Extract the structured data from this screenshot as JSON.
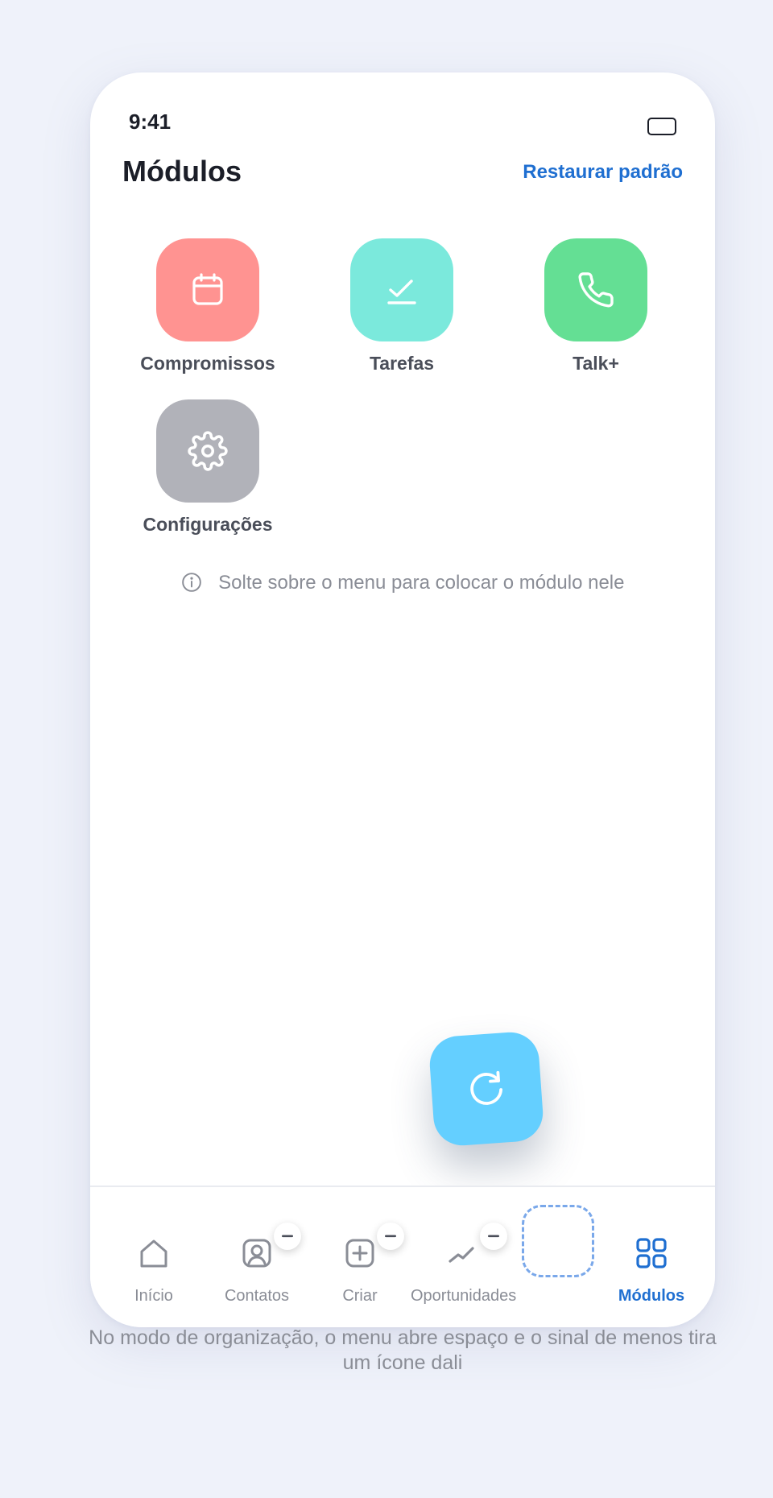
{
  "status_bar": {
    "time": "9:41"
  },
  "header": {
    "title": "Módulos",
    "restore_label": "Restaurar padrão"
  },
  "modules": [
    {
      "label": "Compromissos",
      "icon": "calendar-icon",
      "color": "#ff9391"
    },
    {
      "label": "Tarefas",
      "icon": "check-icon",
      "color": "#7be9dc"
    },
    {
      "label": "Talk+",
      "icon": "phone-icon",
      "color": "#64df94"
    },
    {
      "label": "Configurações",
      "icon": "gear-icon",
      "color": "#b1b2b9"
    }
  ],
  "hint": {
    "text": "Solte sobre o menu para colocar o módulo nele",
    "icon": "info-icon"
  },
  "dragging_module": {
    "icon": "refresh-icon",
    "color": "#64cfff"
  },
  "tabbar": {
    "tabs": [
      {
        "label": "Início",
        "icon": "home-icon"
      },
      {
        "label": "Contatos",
        "icon": "contact-icon",
        "removable": true
      },
      {
        "label": "Criar",
        "icon": "plus-icon",
        "removable": true
      },
      {
        "label": "Oportunidades",
        "icon": "trend-icon",
        "removable": true
      },
      {
        "label": "Módulos",
        "icon": "grid-icon",
        "active": true
      }
    ]
  },
  "caption": "No modo de organização, o menu abre espaço e o sinal de menos tira um ícone dali",
  "colors": {
    "accent": "#1f6fd1",
    "background": "#eff2fa"
  }
}
